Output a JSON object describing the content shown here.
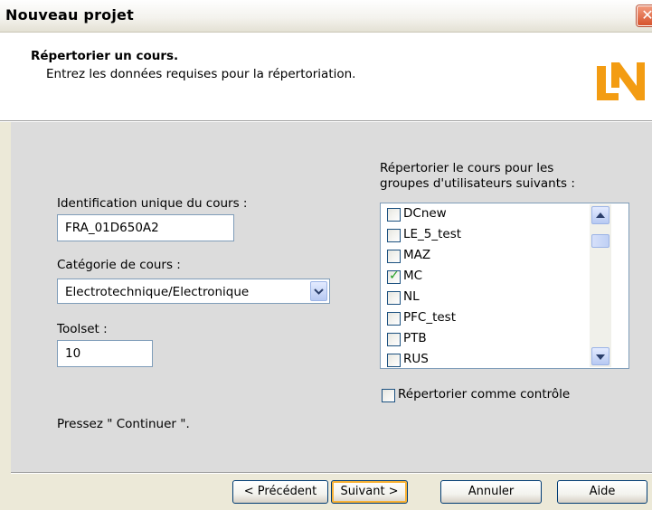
{
  "window": {
    "title": "Nouveau projet",
    "close_glyph": "✕"
  },
  "header": {
    "title": "Répertorier un cours.",
    "subtitle": "Entrez les données requises pour la répertoriation.",
    "logo_icon": "ln-logo",
    "logo_color": "#f39c12"
  },
  "form": {
    "course_id_label": "Identification unique du cours :",
    "course_id_value": "FRA_01D650A2",
    "category_label": "Catégorie de cours :",
    "category_value": "Electrotechnique/Electronique",
    "toolset_label": "Toolset :",
    "toolset_value": "10",
    "groups_label_line1": "Répertorier le cours pour les",
    "groups_label_line2": "groupes d'utilisateurs suivants :",
    "groups": [
      {
        "label": "DCnew",
        "checked": false
      },
      {
        "label": "LE_5_test",
        "checked": false
      },
      {
        "label": "MAZ",
        "checked": false
      },
      {
        "label": "MC",
        "checked": true
      },
      {
        "label": "NL",
        "checked": false
      },
      {
        "label": "PFC_test",
        "checked": false
      },
      {
        "label": "PTB",
        "checked": false
      },
      {
        "label": "RUS",
        "checked": false
      }
    ],
    "control_label": "Répertorier comme contrôle",
    "control_checked": false,
    "instruction": "Pressez \" Continuer \"."
  },
  "buttons": {
    "previous": "< Précédent",
    "next": "Suivant >",
    "cancel": "Annuler",
    "help": "Aide"
  }
}
